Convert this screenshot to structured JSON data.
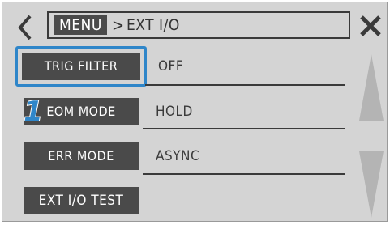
{
  "header": {
    "menu_label": "MENU",
    "separator": ">",
    "current_page": "EXT I/O"
  },
  "settings": [
    {
      "label": "TRIG FILTER",
      "value": "OFF",
      "selected": true
    },
    {
      "label": "EOM MODE",
      "value": "HOLD",
      "selected": false
    },
    {
      "label": "ERR MODE",
      "value": "ASYNC",
      "selected": false
    }
  ],
  "test_button": {
    "label": "EXT I/O TEST"
  },
  "callout": {
    "number": "1"
  },
  "icons": {
    "back": "chevron-left-icon",
    "close": "close-x-icon",
    "scroll_up": "triangle-up-icon",
    "scroll_down": "triangle-down-icon"
  },
  "colors": {
    "background": "#d4d4d4",
    "button": "#4a4a4a",
    "button_text": "#ffffff",
    "highlight": "#2f86c9",
    "badge": "#2f86c9"
  }
}
